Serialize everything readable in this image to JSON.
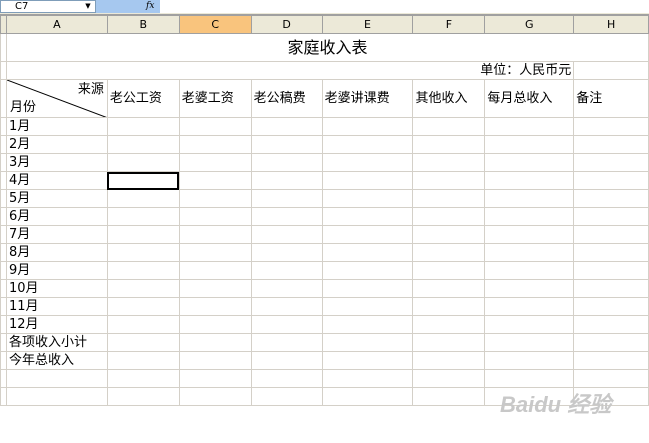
{
  "formula_bar": {
    "name_box": "C7",
    "fx": "fx",
    "formula": ""
  },
  "columns": [
    "A",
    "B",
    "C",
    "D",
    "E",
    "F",
    "G",
    "H"
  ],
  "active_column": "C",
  "sheet": {
    "title": "家庭收入表",
    "unit": "单位：人民币元",
    "corner_top": "来源",
    "corner_bottom": "月份",
    "headers": [
      "老公工资",
      "老婆工资",
      "老公稿费",
      "老婆讲课费",
      "其他收入",
      "每月总收入",
      "备注"
    ],
    "rows": [
      "1月",
      "2月",
      "3月",
      "4月",
      "5月",
      "6月",
      "7月",
      "8月",
      "9月",
      "10月",
      "11月",
      "12月",
      "各项收入小计",
      "今年总收入"
    ]
  },
  "watermark": "Baidu 经验"
}
